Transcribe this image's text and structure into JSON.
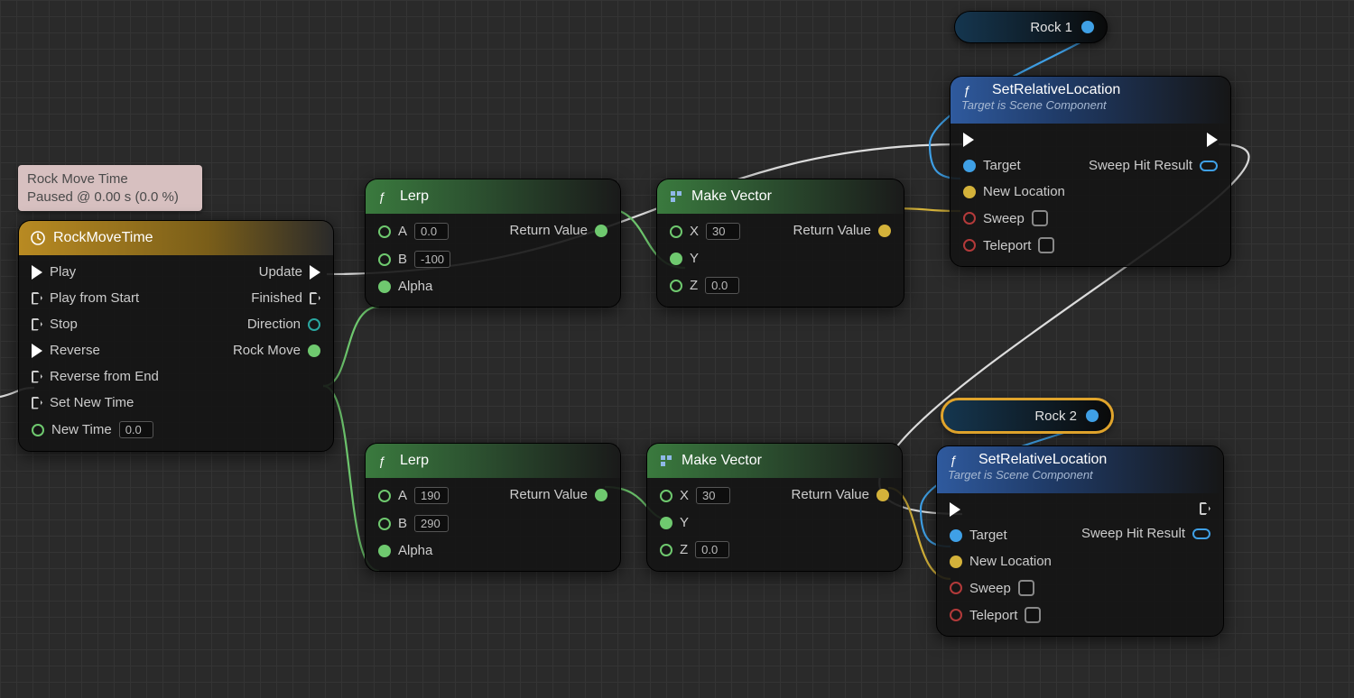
{
  "comment": {
    "line1": "Rock Move Time",
    "line2": "Paused @ 0.00 s (0.0 %)"
  },
  "timeline": {
    "title": "RockMoveTime",
    "inputs": [
      "Play",
      "Play from Start",
      "Stop",
      "Reverse",
      "Reverse from End",
      "Set New Time"
    ],
    "new_time_label": "New Time",
    "new_time_value": "0.0",
    "outputs": {
      "update": "Update",
      "finished": "Finished",
      "direction": "Direction",
      "track": "Rock Move"
    }
  },
  "lerp1": {
    "title": "Lerp",
    "A_label": "A",
    "A_val": "0.0",
    "B_label": "B",
    "B_val": "-100",
    "Alpha": "Alpha",
    "return": "Return Value"
  },
  "lerp2": {
    "title": "Lerp",
    "A_label": "A",
    "A_val": "190",
    "B_label": "B",
    "B_val": "290",
    "Alpha": "Alpha",
    "return": "Return Value"
  },
  "mv1": {
    "title": "Make Vector",
    "X_label": "X",
    "X_val": "30",
    "Y_label": "Y",
    "Z_label": "Z",
    "Z_val": "0.0",
    "return": "Return Value"
  },
  "mv2": {
    "title": "Make Vector",
    "X_label": "X",
    "X_val": "30",
    "Y_label": "Y",
    "Z_label": "Z",
    "Z_val": "0.0",
    "return": "Return Value"
  },
  "var1": {
    "name": "Rock 1"
  },
  "var2": {
    "name": "Rock 2"
  },
  "srl": {
    "title": "SetRelativeLocation",
    "subtitle": "Target is Scene Component",
    "target": "Target",
    "newloc": "New Location",
    "sweep": "Sweep",
    "teleport": "Teleport",
    "sweephit": "Sweep Hit Result"
  }
}
